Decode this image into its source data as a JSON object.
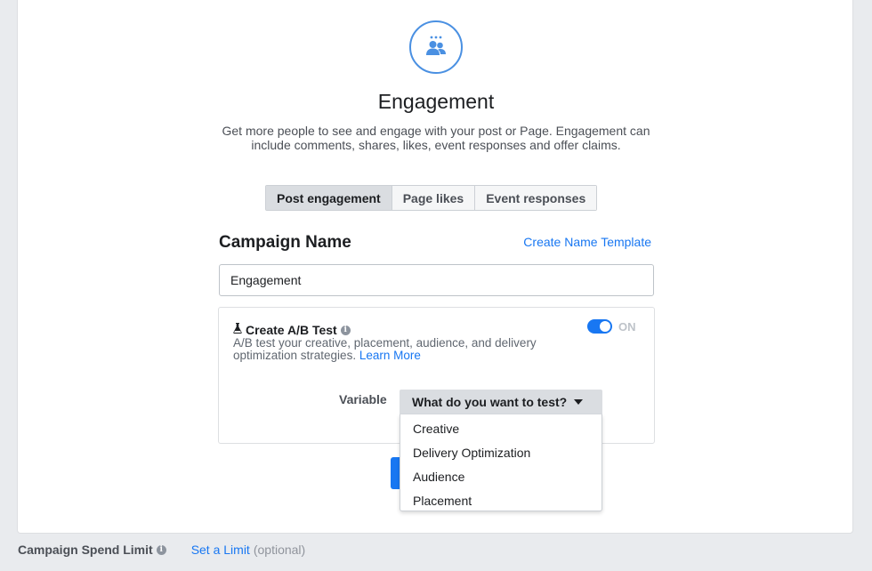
{
  "objective": {
    "icon": "people-engagement-icon",
    "title": "Engagement",
    "description": "Get more people to see and engage with your post or Page. Engagement can include comments, shares, likes, event responses and offer claims."
  },
  "tabs": [
    {
      "label": "Post engagement",
      "active": true
    },
    {
      "label": "Page likes",
      "active": false
    },
    {
      "label": "Event responses",
      "active": false
    }
  ],
  "campaign_name": {
    "heading": "Campaign Name",
    "template_link": "Create Name Template",
    "value": "Engagement"
  },
  "ab_test": {
    "icon": "flask-icon",
    "title": "Create A/B Test",
    "description": "A/B test your creative, placement, audience, and delivery optimization strategies.",
    "learn_more": "Learn More",
    "toggle_label": "ON",
    "toggle_on": true,
    "variable_label": "Variable",
    "select_placeholder": "What do you want to test?",
    "options": [
      "Creative",
      "Delivery Optimization",
      "Audience",
      "Placement"
    ]
  },
  "footer": {
    "label": "Campaign Spend Limit",
    "link": "Set a Limit",
    "optional": "(optional)"
  },
  "colors": {
    "accent": "#1877f2",
    "icon_ring": "#4a90e2",
    "background": "#e9ebee"
  }
}
